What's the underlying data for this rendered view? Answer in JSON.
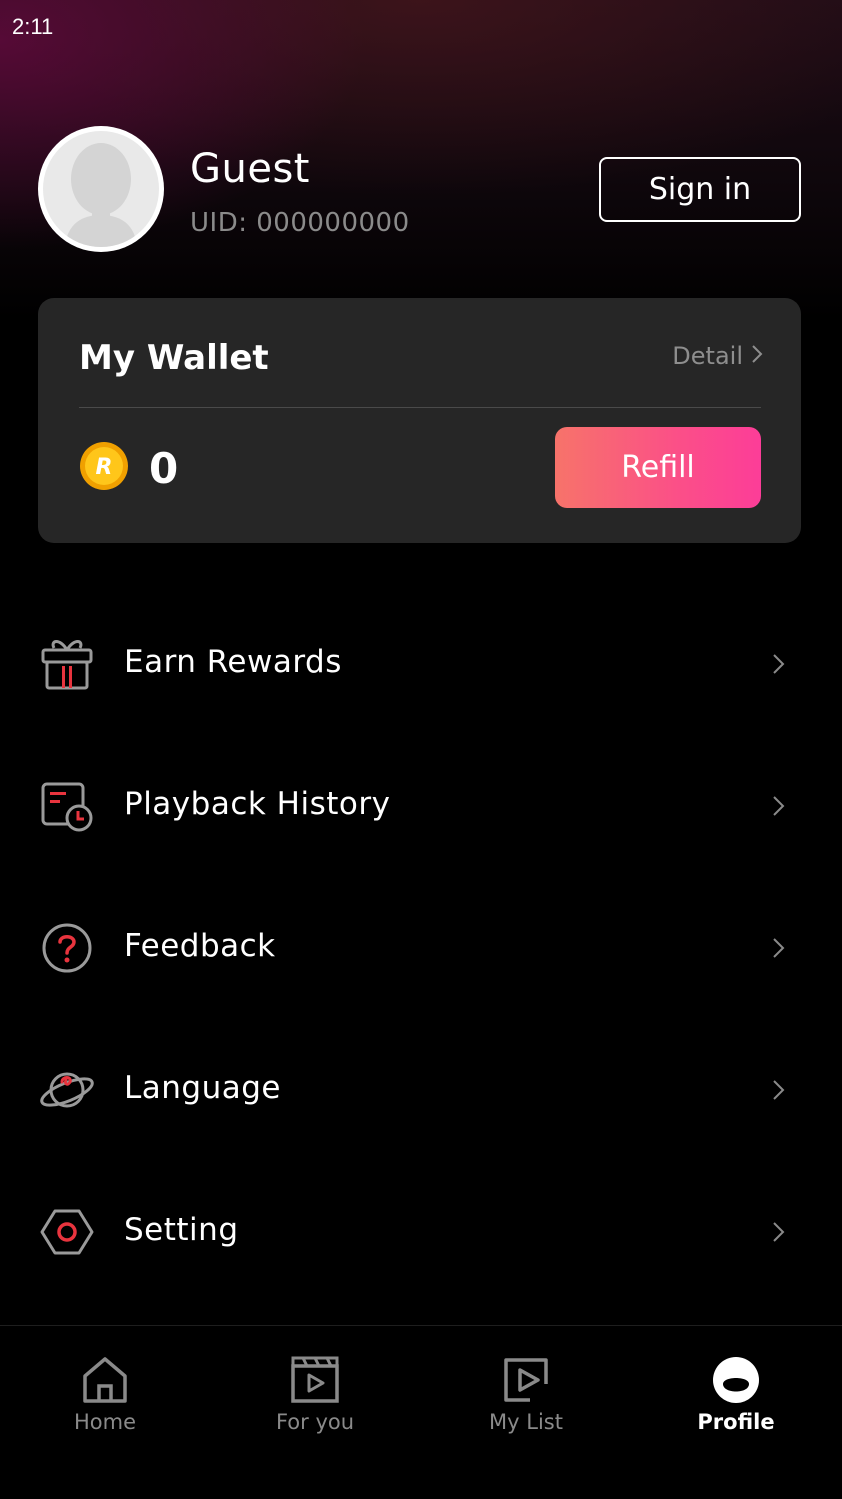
{
  "status_bar": {
    "time": "2:11"
  },
  "profile": {
    "name": "Guest",
    "uid": "UID: 000000000",
    "sign_in_label": "Sign in"
  },
  "wallet": {
    "title": "My Wallet",
    "detail_label": "Detail",
    "balance": "0",
    "refill_label": "Refill",
    "coin_letter": "R"
  },
  "menu": {
    "items": [
      {
        "label": "Earn Rewards",
        "icon": "gift-icon"
      },
      {
        "label": "Playback History",
        "icon": "history-icon"
      },
      {
        "label": "Feedback",
        "icon": "question-icon"
      },
      {
        "label": "Language",
        "icon": "planet-icon"
      },
      {
        "label": "Setting",
        "icon": "hexagon-settings-icon"
      }
    ]
  },
  "bottom_nav": {
    "items": [
      {
        "label": "Home",
        "icon": "home-icon",
        "active": false
      },
      {
        "label": "For you",
        "icon": "clapperboard-icon",
        "active": false
      },
      {
        "label": "My List",
        "icon": "play-list-icon",
        "active": false
      },
      {
        "label": "Profile",
        "icon": "profile-icon",
        "active": true
      }
    ]
  },
  "colors": {
    "accent_red": "#e8343e",
    "refill_gradient_start": "#f7736a",
    "refill_gradient_end": "#fc3d98",
    "wallet_bg": "#262626",
    "coin": "#f5b400"
  }
}
